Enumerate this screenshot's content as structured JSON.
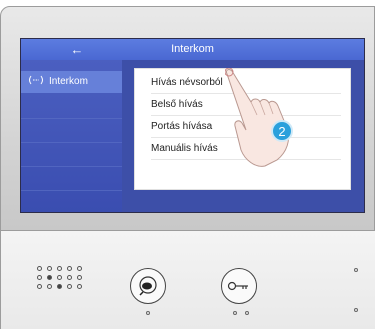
{
  "screen": {
    "title": "Interkom",
    "back_symbol": "←",
    "sidebar": {
      "items": [
        {
          "label": "Interkom",
          "icon": "intercom-icon",
          "selected": true
        }
      ]
    },
    "menu": {
      "items": [
        {
          "label": "Hívás névsorból"
        },
        {
          "label": "Belső hívás"
        },
        {
          "label": "Portás hívása"
        },
        {
          "label": "Manuális hívás"
        }
      ]
    }
  },
  "annotation": {
    "step_number": "2",
    "badge_color": "#2aa0dc"
  },
  "device": {
    "buttons": [
      "talk-button",
      "unlock-key-button"
    ]
  },
  "colors": {
    "titlebar": "#5c7ce0",
    "screen_bg": "#3d4ea6",
    "selected_item": "#6680d9"
  }
}
